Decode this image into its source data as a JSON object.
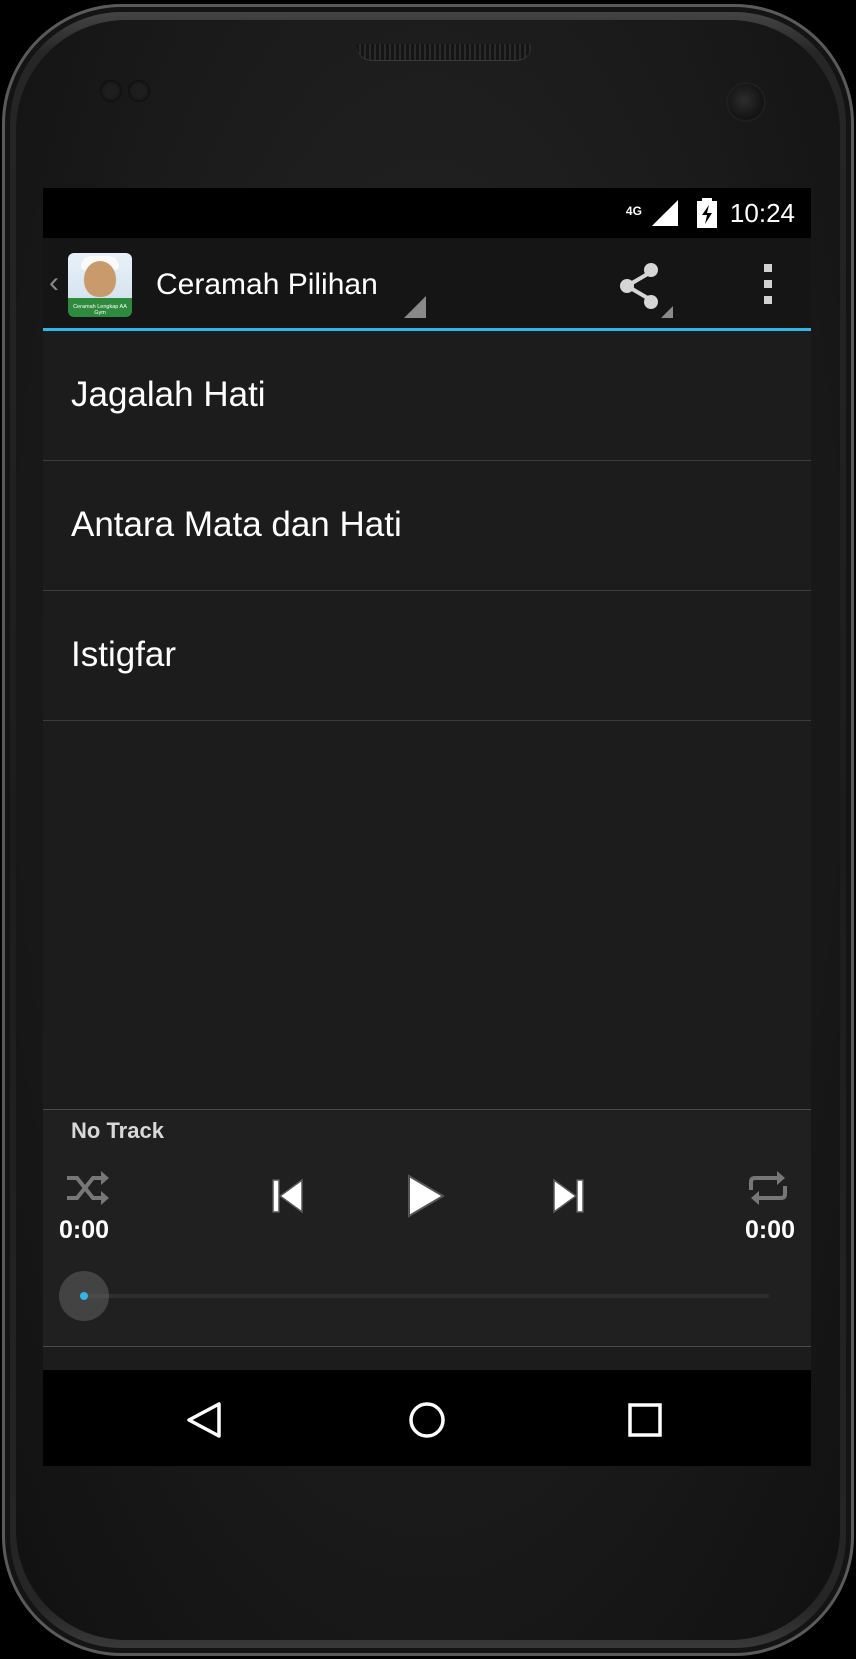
{
  "status_bar": {
    "network": "4G",
    "clock": "10:24"
  },
  "action_bar": {
    "title": "Ceramah Pilihan",
    "app_icon_label": "Ceramah Lengkap AA Gym",
    "share_icon": "share-icon",
    "overflow_icon": "overflow-menu-icon"
  },
  "tracks": [
    {
      "title": "Jagalah Hati"
    },
    {
      "title": "Antara Mata dan Hati"
    },
    {
      "title": "Istigfar"
    }
  ],
  "player": {
    "now_playing": "No Track",
    "elapsed": "0:00",
    "total": "0:00",
    "progress": 0,
    "controls": [
      "shuffle-icon",
      "previous-icon",
      "play-icon",
      "next-icon",
      "repeat-icon"
    ]
  },
  "nav_bar": {
    "buttons": [
      "back-icon",
      "home-icon",
      "recents-icon"
    ]
  },
  "colors": {
    "accent": "#33b5e5",
    "background": "#1c1c1c",
    "action_bar": "#151515"
  }
}
